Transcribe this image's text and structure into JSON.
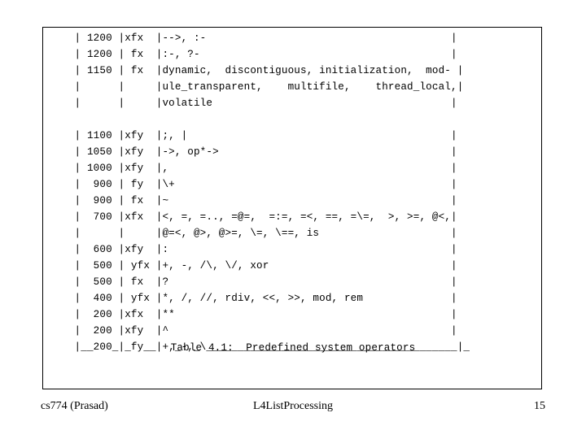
{
  "page": {
    "kind": "lecture-slide",
    "background_color": "#ffffff",
    "text_color": "#000000"
  },
  "table_box": {
    "border_color": "#000000",
    "caption": "Table 4.1:  Predefined system operators",
    "ascii_art": "     | 1200 |xfx  |-->, :-                                       |\n     | 1200 | fx  |:-, ?-                                        |\n     | 1150 | fx  |dynamic,  discontiguous, initialization,  mod- |\n     |      |     |ule_transparent,    multifile,    thread_local,|\n     |      |     |volatile                                      |\n\n     | 1100 |xfy  |;, |                                          |\n     | 1050 |xfy  |->, op*->                                     |\n     | 1000 |xfy  |,                                             |\n     |  900 | fy  |\\+                                            |\n     |  900 | fx  |~                                             |\n     |  700 |xfx  |<, =, =.., =@=,  =:=, =<, ==, =\\=,  >, >=, @<,|\n     |      |     |@=<, @>, @>=, \\=, \\==, is                     |\n     |  600 |xfy  |:                                             |\n     |  500 | yfx |+, -, /\\, \\/, xor                             |\n     |  500 | fx  |?                                             |\n     |  400 | yfx |*, /, //, rdiv, <<, >>, mod, rem              |\n     |  200 |xfx  |**                                            |\n     |  200 |xfy  |^                                             |\n     |__200_|_fy__|+,_-,_\\________________________________________|_",
    "rows": [
      {
        "priority": "1200",
        "type": "xfx",
        "operators": "-->, :-"
      },
      {
        "priority": "1200",
        "type": "fx",
        "operators": ":-, ?-"
      },
      {
        "priority": "1150",
        "type": "fx",
        "operators": "dynamic,  discontiguous, initialization,  module_transparent,    multifile,    thread_local, volatile"
      },
      {
        "priority": "1100",
        "type": "xfy",
        "operators": ";, |"
      },
      {
        "priority": "1050",
        "type": "xfy",
        "operators": "->, op*->"
      },
      {
        "priority": "1000",
        "type": "xfy",
        "operators": ","
      },
      {
        "priority": "900",
        "type": "fy",
        "operators": "\\+"
      },
      {
        "priority": "900",
        "type": "fx",
        "operators": "~"
      },
      {
        "priority": "700",
        "type": "xfx",
        "operators": "<, =, =.., =@=,  =:=, =<, ==, =\\=,  >, >=, @<, @=<, @>, @>=, \\=, \\==, is"
      },
      {
        "priority": "600",
        "type": "xfy",
        "operators": ":"
      },
      {
        "priority": "500",
        "type": "yfx",
        "operators": "+, -, /\\, \\/, xor"
      },
      {
        "priority": "500",
        "type": "fx",
        "operators": "?"
      },
      {
        "priority": "400",
        "type": "yfx",
        "operators": "*, /, //, rdiv, <<, >>, mod, rem"
      },
      {
        "priority": "200",
        "type": "xfx",
        "operators": "**"
      },
      {
        "priority": "200",
        "type": "xfy",
        "operators": "^"
      },
      {
        "priority": "200",
        "type": "fy",
        "operators": "+, -, \\"
      }
    ]
  },
  "footer": {
    "left": "cs774 (Prasad)",
    "center": "L4ListProcessing",
    "right": "15"
  }
}
